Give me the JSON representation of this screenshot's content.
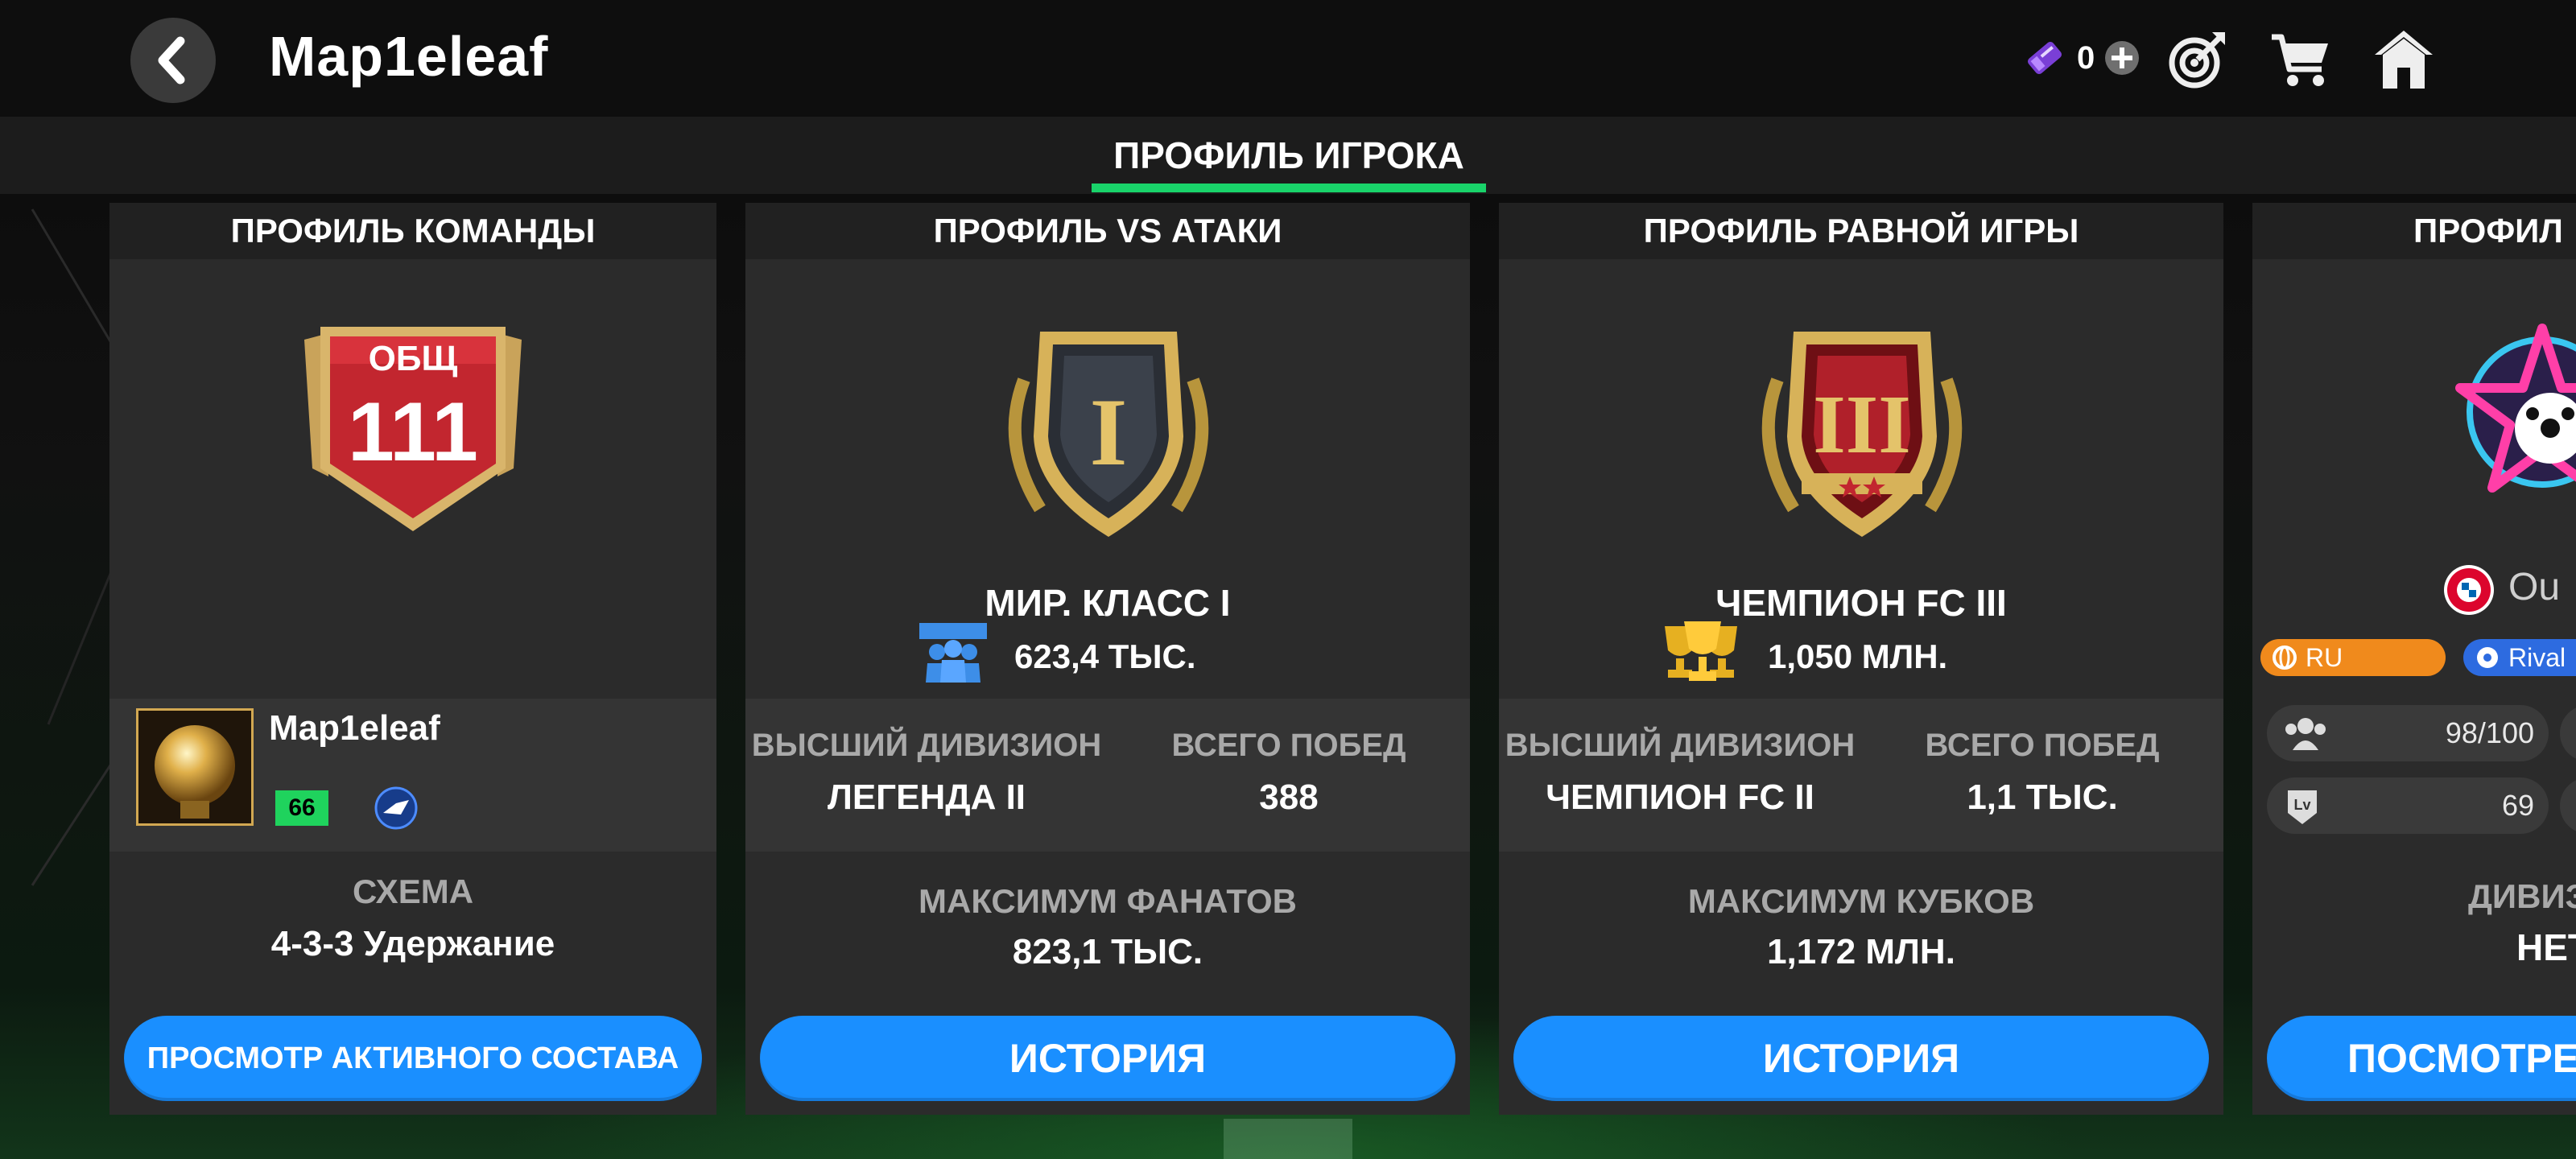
{
  "header": {
    "player_name": "Map1eleaf",
    "currency_amount": "0",
    "icons": [
      "back-icon",
      "gem-icon",
      "add-icon",
      "target-icon",
      "cart-icon",
      "home-icon"
    ]
  },
  "tabs": {
    "active_label": "ПРОФИЛЬ ИГРОКА"
  },
  "team_profile": {
    "title": "ПРОФИЛЬ КОМАНДЫ",
    "ovr_label": "ОБЩ",
    "ovr_value": "111",
    "player_name": "Map1eleaf",
    "level": "66",
    "formation_label": "СХЕМА",
    "formation_value": "4-3-3 Удержание",
    "button_label": "ПРОСМОТР АКТИВНОГО СОСТАВА"
  },
  "vs_attack_profile": {
    "title": "ПРОФИЛЬ VS АТАКИ",
    "badge_numeral": "I",
    "rank_name": "МИР. КЛАСС I",
    "fans": "623,4 ТЫС.",
    "best_division_label": "ВЫСШИЙ ДИВИЗИОН",
    "best_division_value": "ЛЕГЕНДА II",
    "total_wins_label": "ВСЕГО ПОБЕД",
    "total_wins_value": "388",
    "max_label": "МАКСИМУМ ФАНАТОВ",
    "max_value": "823,1 ТЫС.",
    "button_label": "ИСТОРИЯ"
  },
  "h2h_profile": {
    "title": "ПРОФИЛЬ РАВНОЙ ИГРЫ",
    "badge_numeral": "III",
    "rank_name": "ЧЕМПИОН FC III",
    "trophies": "1,050 МЛН.",
    "best_division_label": "ВЫСШИЙ ДИВИЗИОН",
    "best_division_value": "ЧЕМПИОН FC II",
    "total_wins_label": "ВСЕГО ПОБЕД",
    "total_wins_value": "1,1 ТЫС.",
    "max_label": "МАКСИМУМ КУБКОВ",
    "max_value": "1,172 МЛН.",
    "button_label": "ИСТОРИЯ"
  },
  "league_profile": {
    "title": "ПРОФИЛ",
    "name_partial": "Ou",
    "region_tag": "RU",
    "rivals_tag": "Rival",
    "members": "98/100",
    "level": "69",
    "division_label": "ДИВИЗ",
    "division_value": "НЕТ",
    "button_label": "ПОСМОТРЕ"
  },
  "colors": {
    "accent_blue": "#1a8fff",
    "tab_underline_green": "#19d36a",
    "level_badge_green": "#1fd35d",
    "region_orange": "#f08a1c",
    "rivals_blue": "#2d6be0"
  }
}
